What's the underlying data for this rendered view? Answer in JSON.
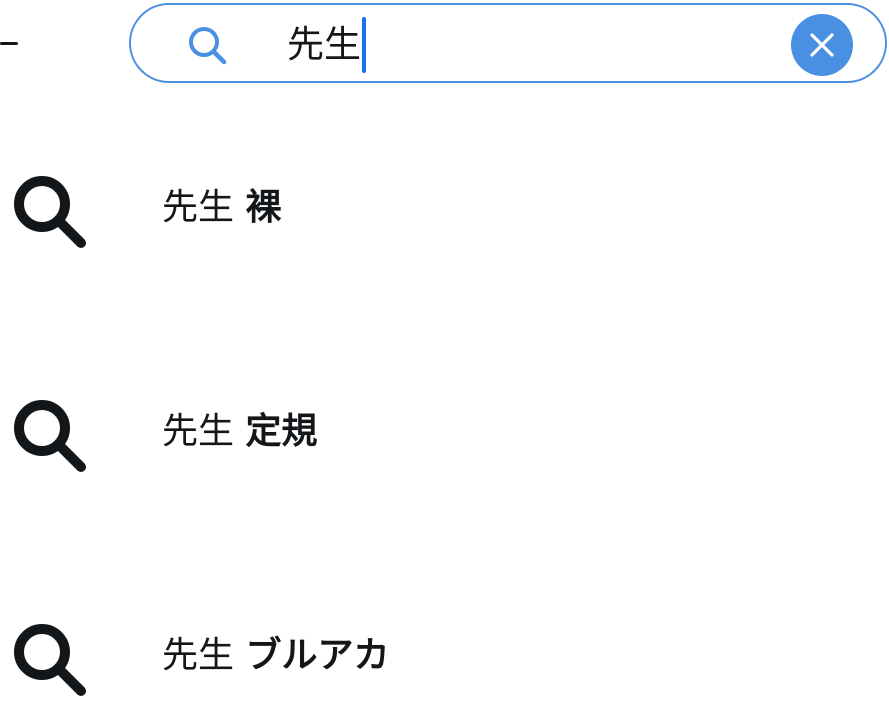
{
  "search": {
    "query": "先生",
    "clear_label": "clear"
  },
  "suggestions": [
    {
      "query": "先生",
      "completion": "裸"
    },
    {
      "query": "先生",
      "completion": "定規"
    },
    {
      "query": "先生",
      "completion": "ブルアカ"
    }
  ],
  "colors": {
    "accent": "#4a90e2",
    "caret": "#1d6ff2",
    "text": "#14171a",
    "background": "#ffffff"
  },
  "icons": {
    "search_bar": "search-icon",
    "clear": "close-icon",
    "suggestion": "search-icon",
    "back": "back-arrow-icon"
  }
}
